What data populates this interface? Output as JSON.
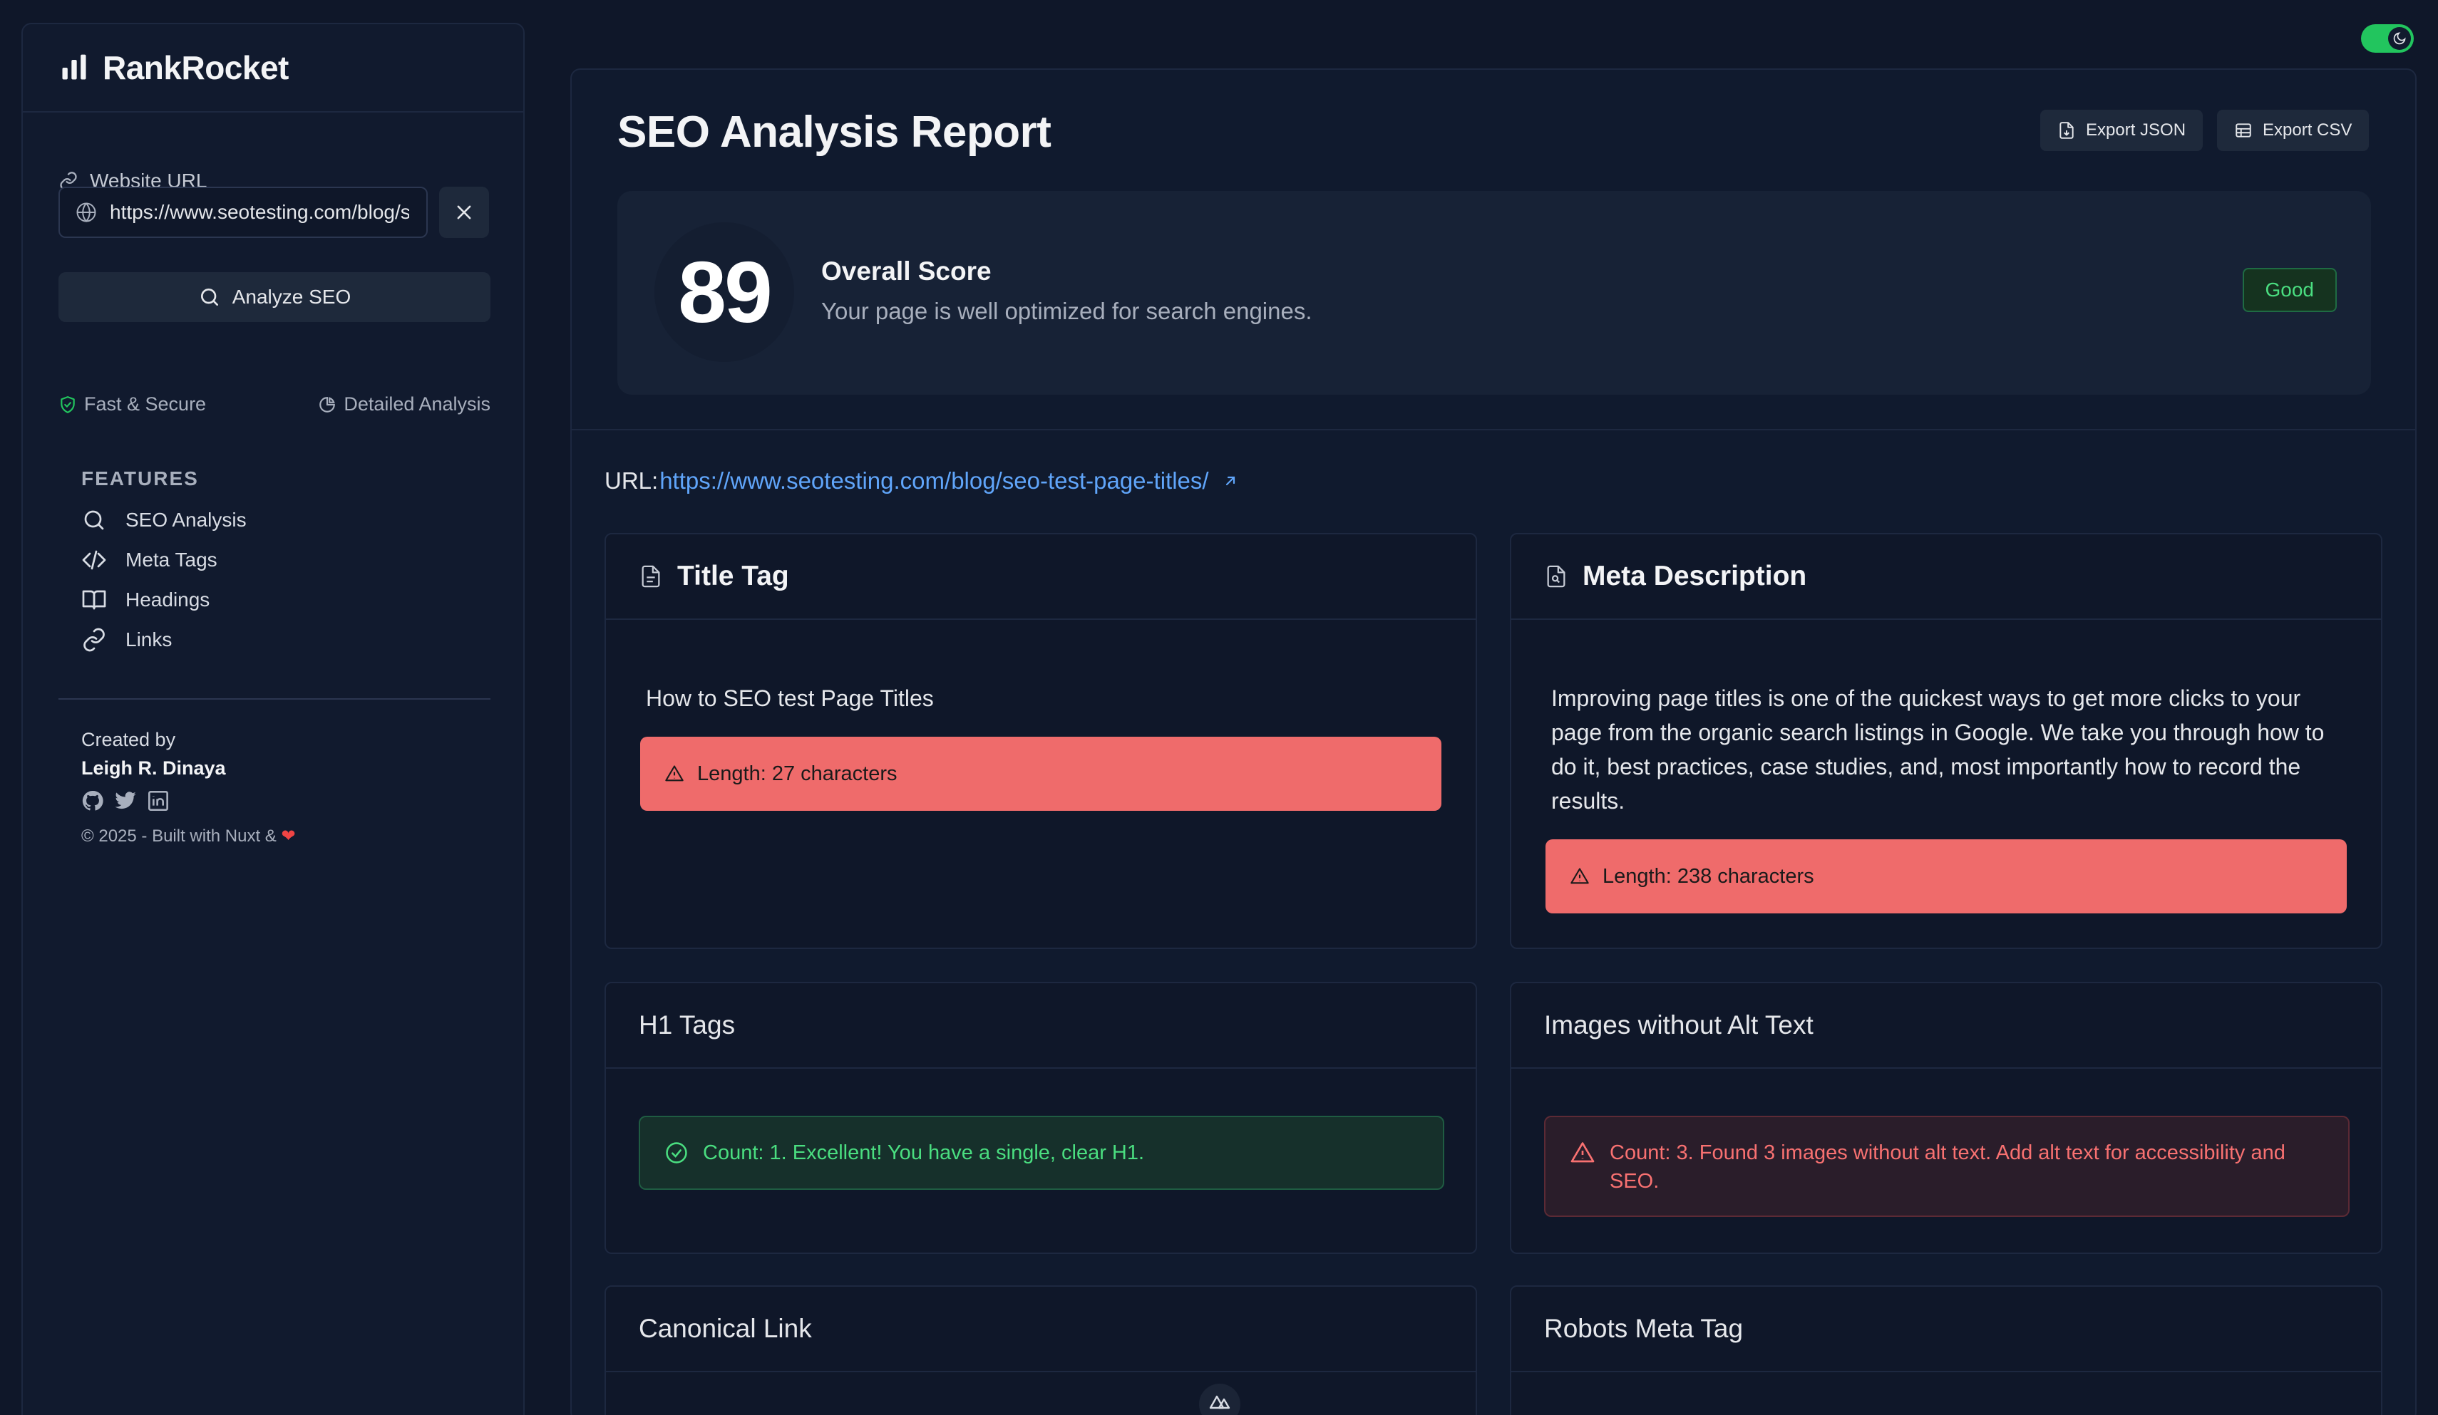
{
  "app": {
    "name": "RankRocket"
  },
  "sidebar": {
    "url_label": "Website URL",
    "url_value": "https://www.seotesting.com/blog/seo-test-page-titles/",
    "analyze_label": "Analyze SEO",
    "badges": [
      "Fast & Secure",
      "Detailed Analysis"
    ],
    "features_title": "FEATURES",
    "nav": [
      {
        "label": "SEO Analysis",
        "icon": "search-icon"
      },
      {
        "label": "Meta Tags",
        "icon": "code-icon"
      },
      {
        "label": "Headings",
        "icon": "book-icon"
      },
      {
        "label": "Links",
        "icon": "link-icon"
      }
    ],
    "created_by": "Created by",
    "author": "Leigh R. Dinaya",
    "copyright": "© 2025 - Built with Nuxt &"
  },
  "report": {
    "title": "SEO Analysis Report",
    "export_json": "Export JSON",
    "export_csv": "Export CSV",
    "score": "89",
    "score_title": "Overall Score",
    "score_desc": "Your page is well optimized for search engines.",
    "score_badge": "Good",
    "url_prefix": "URL:",
    "url": "https://www.seotesting.com/blog/seo-test-page-titles/"
  },
  "cards": {
    "title_tag": {
      "heading": "Title Tag",
      "value": "How to SEO test Page Titles",
      "alert": "Length: 27 characters"
    },
    "meta_description": {
      "heading": "Meta Description",
      "value": "Improving page titles is one of the quickest ways to get more clicks to your page from the organic search listings in Google. We take you through how to do it, best practices, case studies, and, most importantly how to record the results.",
      "alert": "Length: 238 characters"
    },
    "h1_tags": {
      "heading": "H1 Tags",
      "alert": "Count: 1. Excellent! You have a single, clear H1."
    },
    "images_alt": {
      "heading": "Images without Alt Text",
      "alert": "Count: 3. Found 3 images without alt text. Add alt text for accessibility and SEO."
    },
    "canonical": {
      "heading": "Canonical Link"
    },
    "robots": {
      "heading": "Robots Meta Tag"
    }
  },
  "colors": {
    "accent_green": "#22c55e",
    "link_blue": "#60a5fa",
    "alert_red": "#ef6b6b"
  }
}
